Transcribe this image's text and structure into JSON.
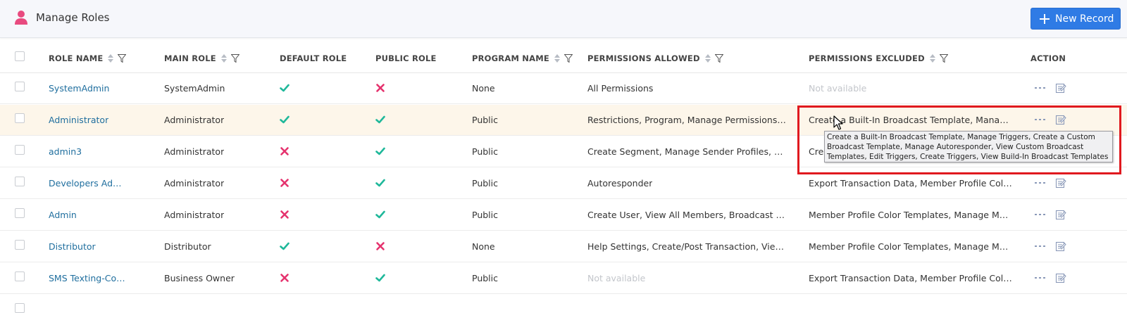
{
  "header": {
    "title": "Manage Roles",
    "new_button_label": "New Record"
  },
  "columns": {
    "role_name": "ROLE NAME",
    "main_role": "MAIN ROLE",
    "default_role": "DEFAULT ROLE",
    "public_role": "PUBLIC ROLE",
    "program_name": "PROGRAM NAME",
    "permissions_allowed": "PERMISSIONS ALLOWED",
    "permissions_excluded": "PERMISSIONS EXCLUDED",
    "action": "ACTION"
  },
  "rows": [
    {
      "role_name": "SystemAdmin",
      "main_role": "SystemAdmin",
      "default_role": true,
      "public_role": false,
      "program_name": "None",
      "permissions_allowed": "All Permissions",
      "permissions_excluded": "Not available"
    },
    {
      "role_name": "Administrator",
      "main_role": "Administrator",
      "default_role": true,
      "public_role": true,
      "program_name": "Public",
      "permissions_allowed": "Restrictions, Program, Manage Permissions, Loc…",
      "permissions_excluded": "Create a Built-In Broadcast Template, Manage…"
    },
    {
      "role_name": "admin3",
      "main_role": "Administrator",
      "default_role": false,
      "public_role": true,
      "program_name": "Public",
      "permissions_allowed": "Create Segment, Manage Sender Profiles, View…",
      "permissions_excluded": "Cre"
    },
    {
      "role_name": "Developers Admin",
      "main_role": "Administrator",
      "default_role": false,
      "public_role": true,
      "program_name": "Public",
      "permissions_allowed": "Autoresponder",
      "permissions_excluded": "Export Transaction Data, Member Profile Color …"
    },
    {
      "role_name": "Admin",
      "main_role": "Administrator",
      "default_role": false,
      "public_role": true,
      "program_name": "Public",
      "permissions_allowed": "Create User, View All Members, Broadcast Stati…",
      "permissions_excluded": "Member Profile Color Templates, Manage Mem…"
    },
    {
      "role_name": "Distributor",
      "main_role": "Distributor",
      "default_role": true,
      "public_role": false,
      "program_name": "None",
      "permissions_allowed": "Help Settings, Create/Post Transaction, View Us…",
      "permissions_excluded": "Member Profile Color Templates, Manage Mem…"
    },
    {
      "role_name": "SMS Texting-Cop…",
      "main_role": "Business Owner",
      "default_role": false,
      "public_role": true,
      "program_name": "Public",
      "permissions_allowed": "Not available",
      "permissions_excluded": "Export Transaction Data, Member Profile Color …"
    }
  ],
  "tooltip": {
    "text": "Create a Built-In Broadcast Template, Manage Triggers, Create a Custom Broadcast Template, Manage Autoresponder, View Custom Broadcast Templates, Edit Triggers, Create Triggers, View Build-In Broadcast Templates"
  },
  "colors": {
    "check": "#1fb89a",
    "cross": "#e5336e",
    "link": "#1f6e9e",
    "accent": "#2f7be5",
    "highlight_box": "#e0191f"
  },
  "icons": {
    "header": "user-icon",
    "check": "check-icon",
    "cross": "cross-icon",
    "row_more": "more-dots-icon",
    "row_edit": "edit-icon",
    "sort": "sort-icon",
    "filter": "filter-icon"
  }
}
